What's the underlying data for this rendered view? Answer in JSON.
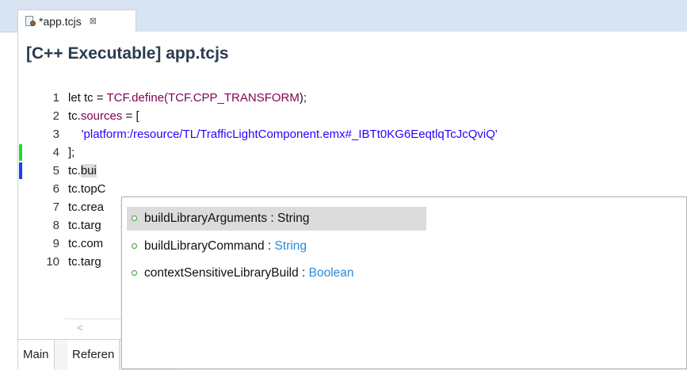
{
  "tab": {
    "title": "*app.tcjs",
    "close": "⊠"
  },
  "editor": {
    "header": "[C++ Executable] app.tcjs",
    "lines": [
      {
        "num": "1",
        "parts": [
          "let tc = ",
          "TCF.define(",
          "TCF.CPP_TRANSFORM",
          ");"
        ]
      },
      {
        "num": "2",
        "parts": [
          "tc.",
          "sources",
          " = ["
        ]
      },
      {
        "num": "3",
        "parts": [
          "    'platform:/resource/TL/TrafficLightComponent.emx#_IBTt0KG6EeqtlqTcJcQviQ'"
        ]
      },
      {
        "num": "4",
        "parts": [
          "];"
        ]
      },
      {
        "num": "5",
        "parts": [
          "tc.",
          "bui"
        ]
      },
      {
        "num": "6",
        "parts": [
          "tc.topC"
        ]
      },
      {
        "num": "7",
        "parts": [
          "tc.crea"
        ]
      },
      {
        "num": "8",
        "parts": [
          "tc.targ"
        ]
      },
      {
        "num": "9",
        "parts": [
          "tc.com"
        ]
      },
      {
        "num": "10",
        "parts": [
          "tc.targ"
        ]
      }
    ],
    "scroll_left": "<"
  },
  "bottom_tabs": [
    "Main",
    "Referen"
  ],
  "autocomplete": [
    {
      "name": "buildLibraryArguments",
      "sep": " : ",
      "type": "String"
    },
    {
      "name": "buildLibraryCommand",
      "sep": " : ",
      "type": "String"
    },
    {
      "name": "contextSensitiveLibraryBuild",
      "sep": " : ",
      "type": "Boolean"
    }
  ],
  "colors": {
    "changed_marker": "#22dd22",
    "current_marker": "#1a3cff",
    "keyword": "#7f0055",
    "string": "#2a00ff",
    "type": "#2a8bd8"
  },
  "icons": [
    "file-icon",
    "close-icon",
    "autocomplete-field-icon"
  ]
}
